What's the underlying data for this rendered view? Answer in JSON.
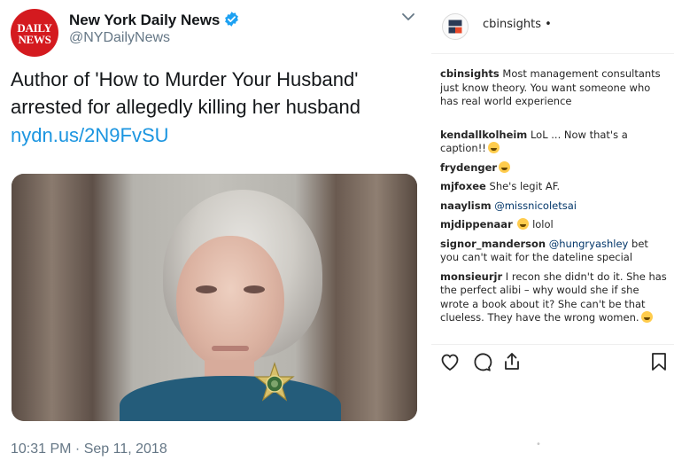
{
  "tweet": {
    "avatar_line1": "DAILY",
    "avatar_line2": "NEWS",
    "display_name": "New York Daily News",
    "handle": "@NYDailyNews",
    "text": "Author of 'How to Murder Your Husband' arrested for allegedly killing her husband",
    "link": "nydn.us/2N9FvSU",
    "timestamp": "10:31 PM · Sep 11, 2018",
    "icons": {
      "verified": "verified-badge-icon",
      "caret": "chevron-down-icon"
    },
    "colors": {
      "brand_red": "#d41a1f",
      "link_blue": "#1b95e0",
      "verified_blue": "#1da1f2"
    }
  },
  "instagram": {
    "username": "cbinsights",
    "dot": "•",
    "caption": {
      "user": "cbinsights",
      "text": "Most management consultants just know theory. You want someone who has real world experience"
    },
    "comments": [
      {
        "user": "kendallkolheim",
        "text": "LoL ... Now that's a caption!!",
        "emoji": "laughing-face-emoji"
      },
      {
        "user": "frydenger",
        "text": "",
        "emoji": "rofl-face-emoji"
      },
      {
        "user": "mjfoxee",
        "text": "She's legit AF."
      },
      {
        "user": "naaylism",
        "mention": "@missnicoletsai",
        "text": ""
      },
      {
        "user": "mjdippenaar",
        "text": "lolol",
        "emoji_before": "joy-face-emoji"
      },
      {
        "user": "signor_manderson",
        "mention": "@hungryashley",
        "text": "bet you can't wait for the dateline special"
      },
      {
        "user": "monsieurjr",
        "text": "I recon she didn't do it. She has the perfect alibi – why would she if she wrote a book about it? She can't be that clueless. They have the wrong women.",
        "emoji": "joy-face-emoji"
      }
    ],
    "actions": [
      "heart-icon",
      "comment-icon",
      "share-icon",
      "bookmark-icon"
    ],
    "bottom_mark": "•"
  }
}
